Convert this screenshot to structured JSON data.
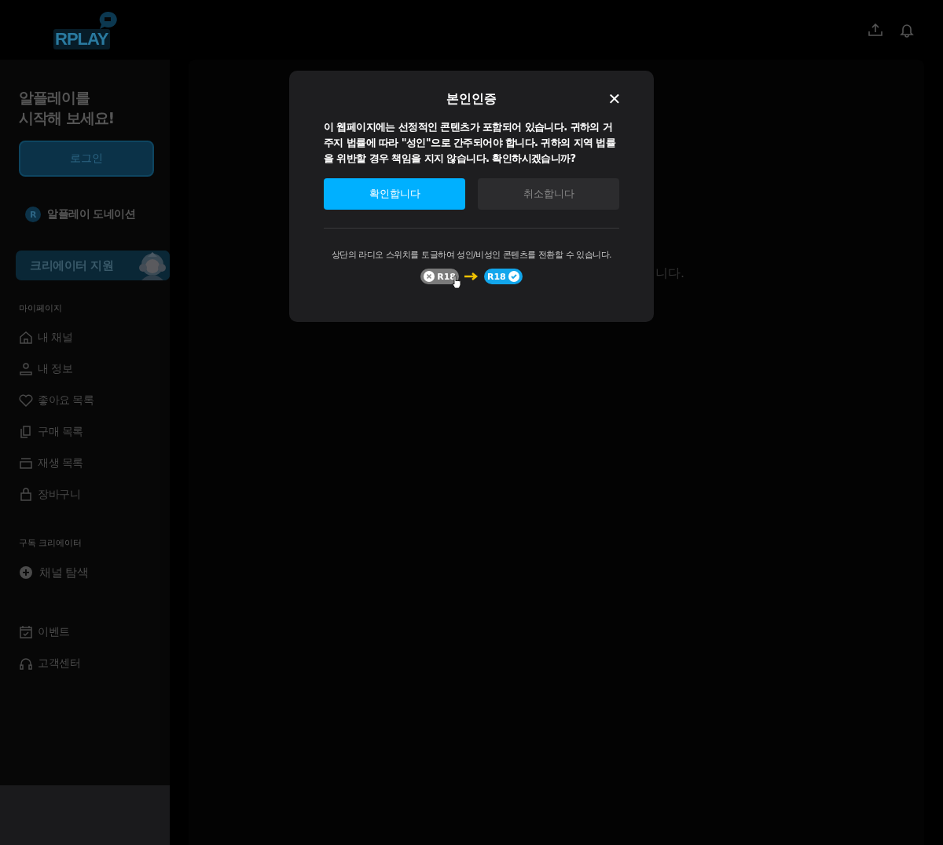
{
  "header": {
    "logo": "RPLAY"
  },
  "sidebar": {
    "welcome": "알플레이를\n시작해 보세요!",
    "login_button": "로그인",
    "donation": {
      "badge": "R",
      "label": "알플레이 도네이션"
    },
    "creator_support": "크리에이터 지원",
    "sections": [
      {
        "title": "마이페이지",
        "items": [
          {
            "kind": "home",
            "label": "내 채널"
          },
          {
            "kind": "user",
            "label": "내 정보"
          },
          {
            "kind": "heart",
            "label": "좋아요 목록"
          },
          {
            "kind": "copy",
            "label": "구매 목록"
          },
          {
            "kind": "stack",
            "label": "재생 목록"
          },
          {
            "kind": "bag",
            "label": "장바구니"
          }
        ]
      },
      {
        "title": "구독 크리에이터",
        "items": [
          {
            "kind": "plus",
            "label": "채널 탐색"
          }
        ]
      }
    ],
    "footer_items": [
      {
        "kind": "calendar",
        "label": "이벤트"
      },
      {
        "kind": "headset",
        "label": "고객센터"
      }
    ]
  },
  "main": {
    "message": "니다."
  },
  "dialog": {
    "title": "본인인증",
    "close": "✕",
    "body": "이 웹페이지에는 선정적인 콘텐츠가 포함되어 있습니다. 귀하의 거주지 법률에 따라 \"성인\"으로 간주되어야 합니다. 귀하의 지역 법률을 위반할 경우 책임을 지지 않습니다. 확인하시겠습니까?",
    "buttons": [
      {
        "label": "확인합니다",
        "kind": "primary"
      },
      {
        "label": "취소합니다",
        "kind": "secondary"
      }
    ],
    "hint": "상단의 라디오 스위치를 토글하여 성인/비성인 콘텐츠를 전환할 수 있습니다.",
    "toggles": [
      {
        "label": "R18",
        "on": false
      },
      {
        "label": "R18",
        "on": true
      }
    ]
  }
}
